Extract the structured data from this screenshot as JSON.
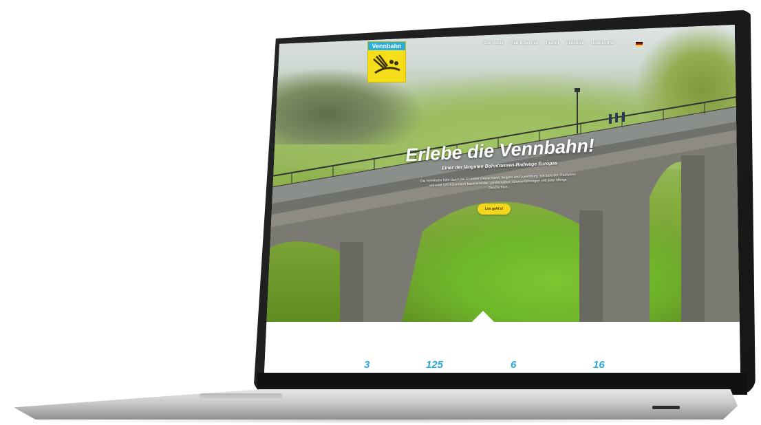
{
  "site": {
    "logo_text": "Vennbahn",
    "nav": [
      "Die Route",
      "Rad & Service",
      "Touren",
      "Aktuelles",
      "Unterkünfte"
    ]
  },
  "hero": {
    "title": "Erlebe die Vennbahn!",
    "subtitle": "Einer der längsten Bahntrassen-Radwege Europas",
    "body": "Die Vennbahn führt durch die 3 Länder Deutschland, Belgien und Luxemburg. Sie lockt den Radfahrer mit rund 125 Kilometern faszinierender Landschaften, Grenzerfahrungen und jeder Menge Geschichten.",
    "cta": "Los geht's!"
  },
  "stats": [
    "3",
    "125",
    "6",
    "16"
  ],
  "colors": {
    "accent_blue": "#27a7da",
    "logo_yellow": "#f5dd1a",
    "cta_yellow": "#f4d71c"
  }
}
